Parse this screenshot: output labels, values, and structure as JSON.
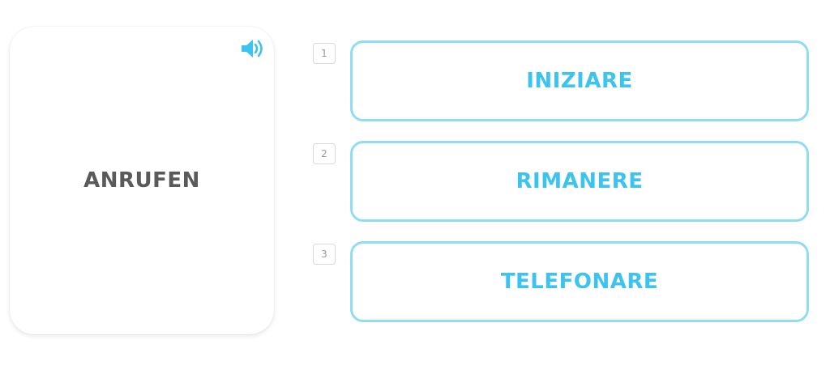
{
  "prompt": {
    "word": "ANRUFEN",
    "audio_icon": "speaker-icon"
  },
  "options": [
    {
      "key": "1",
      "label": "INIZIARE"
    },
    {
      "key": "2",
      "label": "RIMANERE"
    },
    {
      "key": "3",
      "label": "TELEFONARE"
    }
  ],
  "colors": {
    "accent": "#3cc3f0",
    "option_border": "#8fdcf5",
    "prompt_text": "#5a5a5a"
  }
}
